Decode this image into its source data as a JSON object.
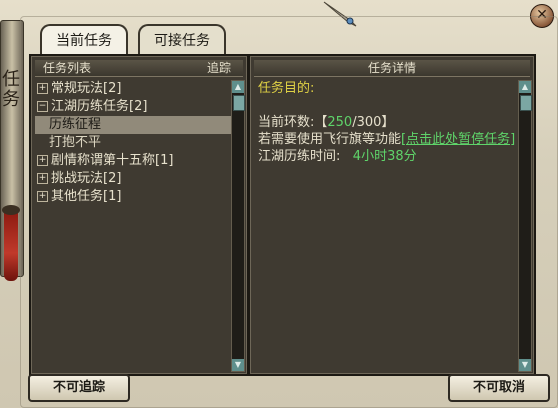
{
  "tabs": {
    "current": "当前任务",
    "acceptable": "可接任务"
  },
  "side_scroll": {
    "text": "任务"
  },
  "left_panel": {
    "header_title": "任务列表",
    "header_track": "追踪",
    "rows": [
      {
        "label": "常规玩法[2]",
        "expander": "+"
      },
      {
        "label": "江湖历练任务[2]",
        "expander": "−"
      },
      {
        "label": "历练征程"
      },
      {
        "label": "打抱不平"
      },
      {
        "label": "剧情称谓第十五称[1]",
        "expander": "+"
      },
      {
        "label": "挑战玩法[2]",
        "expander": "+"
      },
      {
        "label": "其他任务[1]",
        "expander": "+"
      }
    ]
  },
  "right_panel": {
    "header_title": "任务详情",
    "goal_label": "任务目的:",
    "ring_prefix": "当前环数:【",
    "ring_current": "250",
    "ring_total": "/300】",
    "flag_text": "若需要使用飞行旗等功能",
    "flag_link": "[点击此处暂停任务]",
    "time_label": "江湖历练时间:",
    "time_value": "4小时38分"
  },
  "buttons": {
    "untrack": "不可追踪",
    "cancel": "不可取消"
  },
  "icons": {
    "close": "close-icon",
    "expand": "plus-icon",
    "collapse": "minus-icon",
    "scroll_up": "arrow-up-icon",
    "scroll_down": "arrow-down-icon"
  }
}
